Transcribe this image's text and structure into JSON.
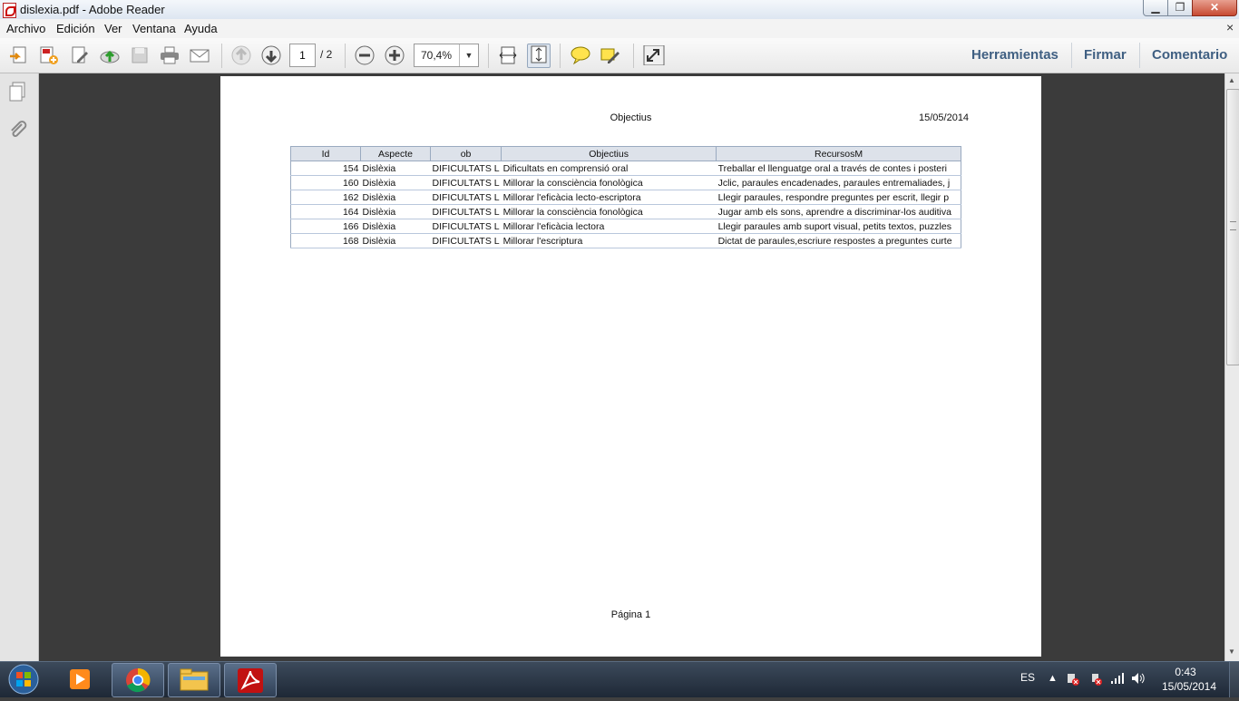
{
  "window": {
    "title": "dislexia.pdf - Adobe Reader",
    "controls": {
      "minimize": "▁",
      "maximize": "❐",
      "close": "✕"
    }
  },
  "menu": {
    "items": [
      "Archivo",
      "Edición",
      "Ver",
      "Ventana",
      "Ayuda"
    ],
    "close_glyph": "×"
  },
  "toolbar": {
    "page_current": "1",
    "page_total": "/ 2",
    "zoom": "70,4%",
    "zoom_arrow": "▼",
    "right_links": [
      "Herramientas",
      "Firmar",
      "Comentario"
    ]
  },
  "document": {
    "title": "Objectius",
    "date": "15/05/2014",
    "footer": "Página 1",
    "table": {
      "headers": [
        "Id",
        "Aspecte",
        "ob",
        "Objectius",
        "RecursosM"
      ],
      "rows": [
        [
          "154",
          "Dislèxia",
          "DIFICULTATS L",
          "Dificultats en comprensió oral",
          "Treballar el llenguatge oral a través de contes i posteri"
        ],
        [
          "160",
          "Dislèxia",
          "DIFICULTATS L",
          "Millorar la consciència fonològica",
          "Jclic, paraules encadenades,  paraules entremaliades, j"
        ],
        [
          "162",
          "Dislèxia",
          "DIFICULTATS L",
          "Millorar l'eficàcia lecto-escriptora",
          "Llegir paraules, respondre preguntes per escrit, llegir p"
        ],
        [
          "164",
          "Dislèxia",
          "DIFICULTATS L",
          "Millorar la consciència fonològica",
          "Jugar amb els sons, aprendre a discriminar-los auditiva"
        ],
        [
          "166",
          "Dislèxia",
          "DIFICULTATS L",
          "Millorar l'eficàcia lectora",
          "Llegir paraules amb suport visual, petits textos, puzzles"
        ],
        [
          "168",
          "Dislèxia",
          "DIFICULTATS L",
          "Millorar l'escriptura",
          "Dictat de paraules,escriure respostes a preguntes curte"
        ]
      ]
    }
  },
  "scrollbar": {
    "up": "▲",
    "down": "▼"
  },
  "taskbar": {
    "language": "ES",
    "tray_arrow": "▲",
    "time": "0:43",
    "date": "15/05/2014"
  },
  "colors": {
    "accent": "#3f5f82",
    "doc_bg": "#3b3b3b",
    "pdf_red": "#c11111"
  }
}
